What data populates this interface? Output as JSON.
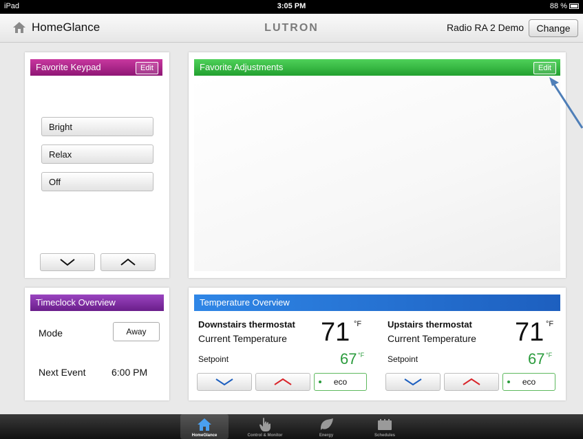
{
  "status_bar": {
    "device": "iPad",
    "time": "3:05 PM",
    "battery": "88 %"
  },
  "header": {
    "title": "HomeGlance",
    "logo": "LUTRON",
    "system_name": "Radio RA 2 Demo",
    "change_label": "Change"
  },
  "favorite_keypad": {
    "title": "Favorite Keypad",
    "edit_label": "Edit",
    "buttons": [
      {
        "label": "Bright"
      },
      {
        "label": "Relax"
      },
      {
        "label": "Off"
      }
    ],
    "colors": {
      "header": "#b01e8f"
    }
  },
  "favorite_adjustments": {
    "title": "Favorite Adjustments",
    "edit_label": "Edit",
    "colors": {
      "header": "#34b53a"
    }
  },
  "timeclock": {
    "title": "Timeclock Overview",
    "mode_label": "Mode",
    "mode_value": "Away",
    "next_event_label": "Next Event",
    "next_event_time": "6:00 PM",
    "colors": {
      "header": "#7b2a9b"
    }
  },
  "temperature": {
    "title": "Temperature Overview",
    "colors": {
      "header": "#1d6fd1",
      "setpoint": "#2a9b3c"
    },
    "thermostats": [
      {
        "name": "Downstairs thermostat",
        "subtitle": "Current Temperature",
        "current": "71",
        "unit": "°F",
        "setpoint_label": "Setpoint",
        "setpoint": "67",
        "setpoint_unit": "°F",
        "eco_label": "eco"
      },
      {
        "name": "Upstairs thermostat",
        "subtitle": "Current Temperature",
        "current": "71",
        "unit": "°F",
        "setpoint_label": "Setpoint",
        "setpoint": "67",
        "setpoint_unit": "°F",
        "eco_label": "eco"
      }
    ]
  },
  "tabs": [
    {
      "label": "HomeGlance",
      "icon": "home-icon",
      "active": true
    },
    {
      "label": "Control & Monitor",
      "icon": "hand-pointer-icon",
      "active": false
    },
    {
      "label": "Energy",
      "icon": "leaf-icon",
      "active": false
    },
    {
      "label": "Schedules",
      "icon": "calendar-icon",
      "active": false
    }
  ]
}
